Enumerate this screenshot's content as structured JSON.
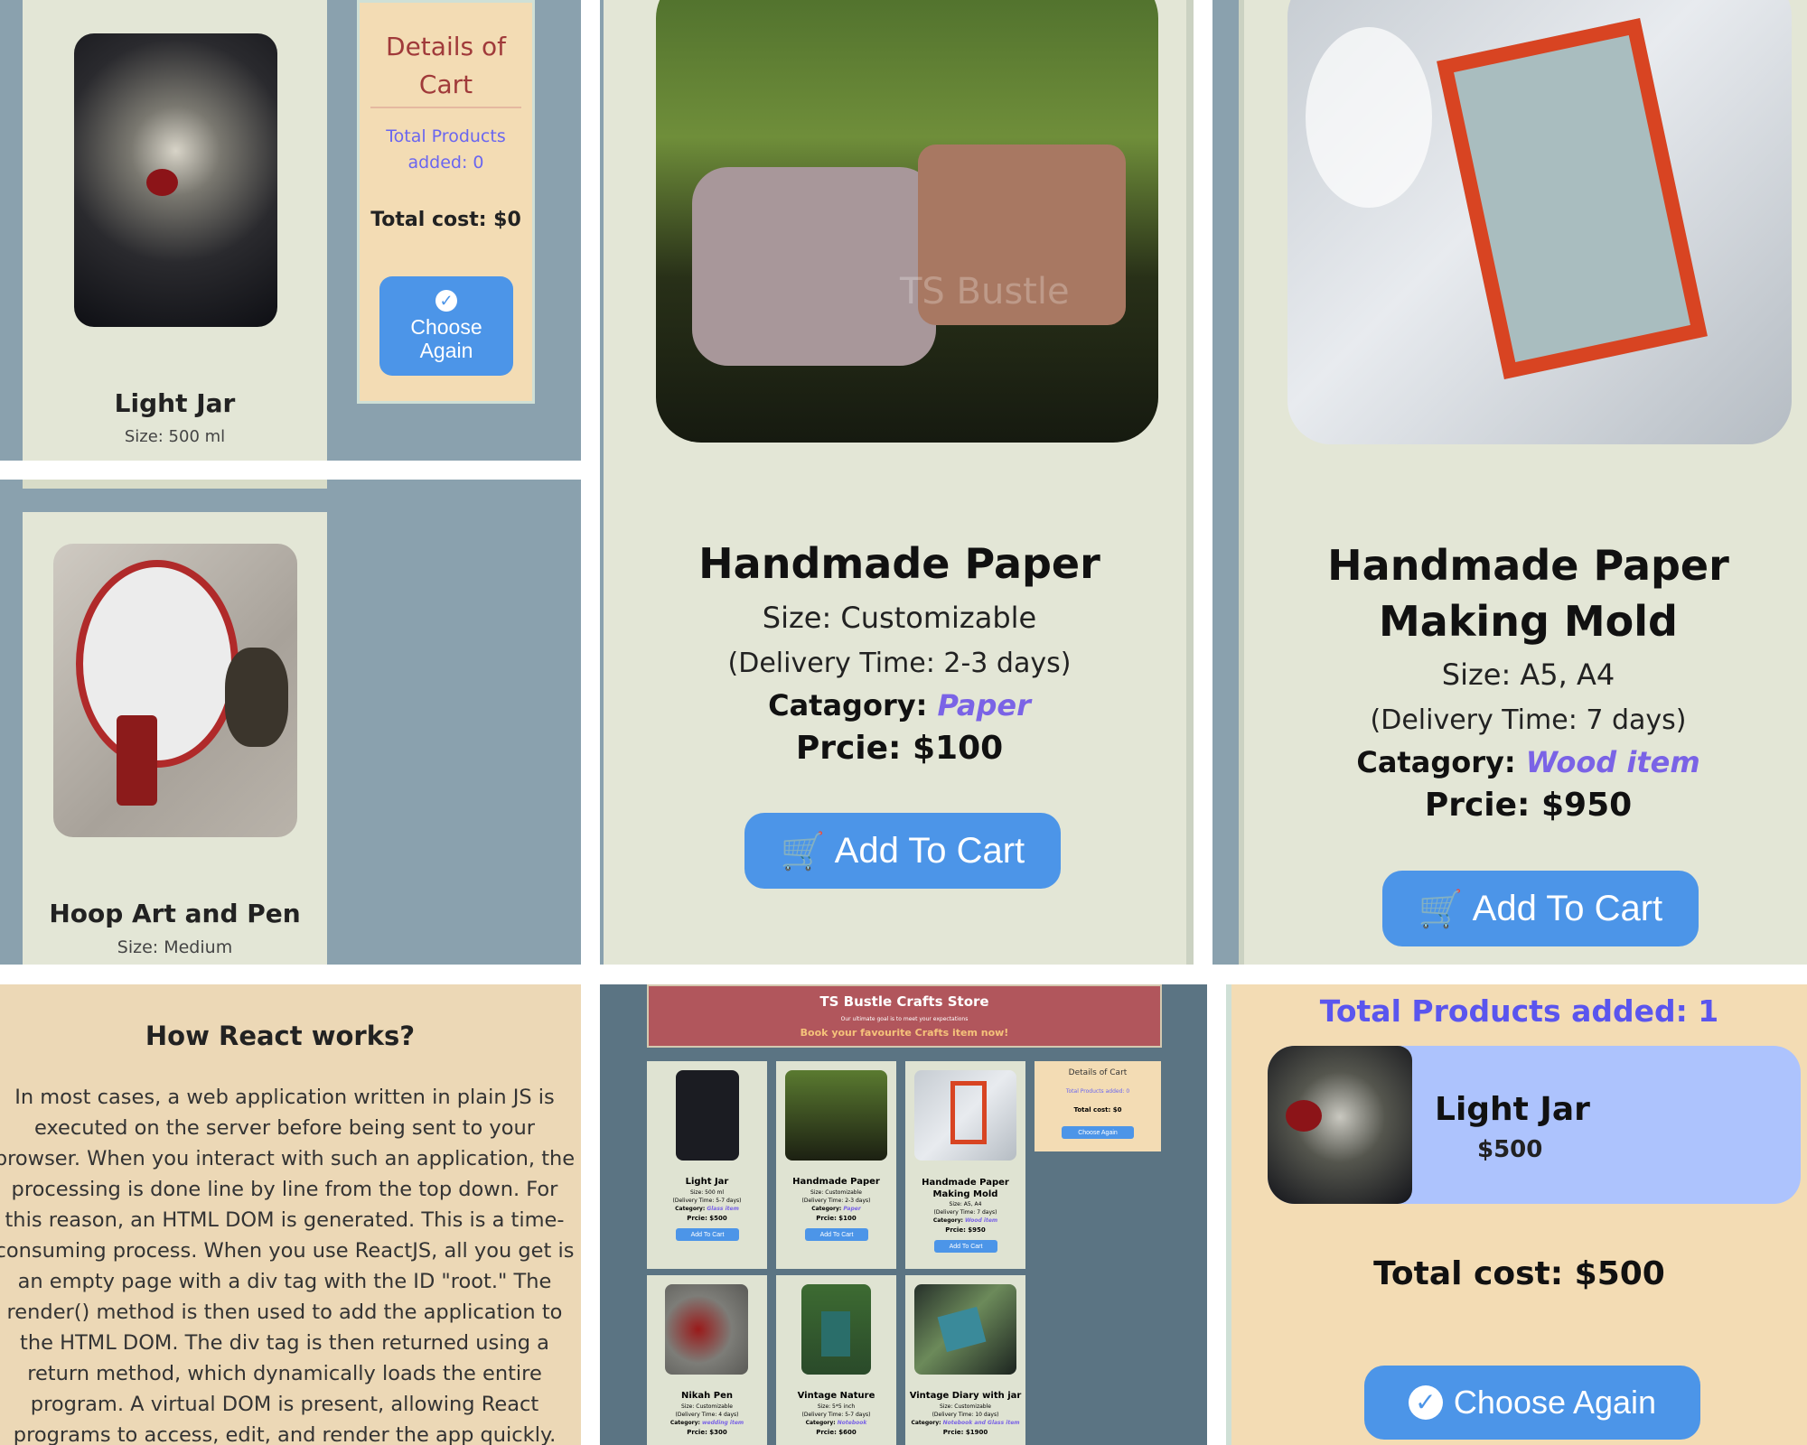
{
  "colors": {
    "slate_bg": "#8aa1ae",
    "card_bg": "#e3e6d6",
    "cart_bg": "#f3dcb4",
    "button_blue": "#4c95e8",
    "link_purple": "#7a63e6",
    "store_header": "#b1565c",
    "cart_item_bg": "#adc3fd"
  },
  "panel_tl": {
    "cart": {
      "title": "Details of Cart",
      "total_products": "Total Products added: 0",
      "total_cost": "Total cost: $0",
      "choose_again": "Choose Again",
      "icon": "check-circle-icon"
    },
    "card1": {
      "name": "Light Jar",
      "size": "Size: 500 ml"
    },
    "card2": {
      "name": "Hoop Art and Pen",
      "size": "Size: Medium"
    }
  },
  "panel_tm": {
    "name": "Handmade Paper",
    "size": "Size: Customizable",
    "delivery": "(Delivery Time: 2-3 days)",
    "category_label": "Catagory:",
    "category": "Paper",
    "price": "Prcie: $100",
    "button": "Add To Cart",
    "icon": "cart-icon",
    "watermark": "TS Bustle"
  },
  "panel_tr": {
    "name": "Handmade Paper Making Mold",
    "size": "Size: A5, A4",
    "delivery": "(Delivery Time: 7 days)",
    "category_label": "Catagory:",
    "category": "Wood item",
    "price": "Prcie: $950",
    "button": "Add To Cart",
    "icon": "cart-icon"
  },
  "panel_bl": {
    "heading": "How React works?",
    "body": "In most cases, a web application written in plain JS is executed on the server before being sent to your browser. When you interact with such an application, the processing is done line by line from the top down. For this reason, an HTML DOM is generated. This is a time-consuming process. When you use ReactJS, all you get is an empty page with a div tag with the ID \"root.\" The render() method is then used to add the application to the HTML DOM. The div tag is then returned using a return method, which dynamically loads the entire program. A virtual DOM is present, allowing React programs to access, edit, and render the app quickly."
  },
  "panel_bm": {
    "store_title": "TS Bustle Crafts Store",
    "store_sub": "Our ultimate goal is to meet your expectations",
    "store_tag": "Book your favourite Crafts item now!",
    "cart": {
      "title": "Details of Cart",
      "total_products": "Total Products added: 0",
      "total_cost": "Total cost: $0",
      "choose_again": "Choose Again"
    },
    "products": [
      {
        "name": "Light Jar",
        "size": "Size: 500 ml",
        "delivery": "(Delivery Time: 5-7 days)",
        "category": "Glass item",
        "price": "Prcie: $500",
        "button": "Add To Cart"
      },
      {
        "name": "Handmade Paper",
        "size": "Size: Customizable",
        "delivery": "(Delivery Time: 2-3 days)",
        "category": "Paper",
        "price": "Prcie: $100",
        "button": "Add To Cart"
      },
      {
        "name": "Handmade Paper Making Mold",
        "size": "Size: A5, A4",
        "delivery": "(Delivery Time: 7 days)",
        "category": "Wood item",
        "price": "Prcie: $950",
        "button": "Add To Cart"
      },
      {
        "name": "Nikah Pen",
        "size": "Size: Customizable",
        "delivery": "(Delivery Time: 4 days)",
        "category": "wedding item",
        "price": "Prcie: $300"
      },
      {
        "name": "Vintage Nature",
        "size": "Size: 5*5 inch",
        "delivery": "(Delivery Time: 5-7 days)",
        "category": "Notebook",
        "price": "Prcie: $600"
      },
      {
        "name": "Vintage Diary with jar",
        "size": "Size: Customizable",
        "delivery": "(Delivery Time: 10 days)",
        "category": "Notebook and Glass item",
        "price": "Prcie: $1900"
      }
    ],
    "category_label": "Category:"
  },
  "panel_br": {
    "total_products": "Total Products added: 1",
    "item_name": "Light Jar",
    "item_price": "$500",
    "total_cost": "Total cost: $500",
    "choose_again": "Choose Again",
    "icon": "check-circle-icon"
  }
}
